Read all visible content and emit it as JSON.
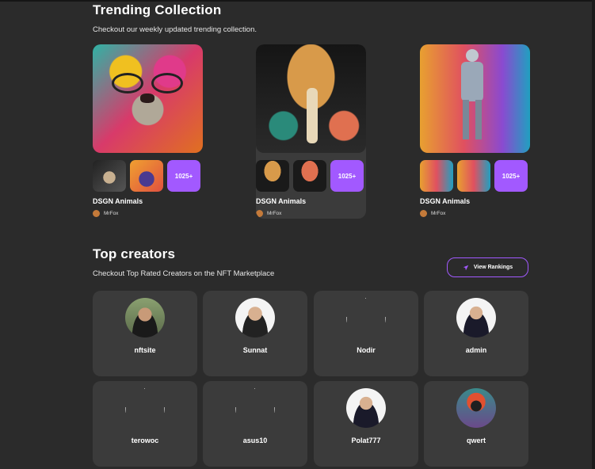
{
  "trending": {
    "title": "Trending Collection",
    "subtitle": "Checkout our weekly updated trending collection.",
    "collections": [
      {
        "name": "DSGN Animals",
        "artist": "MrFox",
        "count": "1025+"
      },
      {
        "name": "DSGN Animals",
        "artist": "MrFox",
        "count": "1025+"
      },
      {
        "name": "DSGN Animals",
        "artist": "MrFox",
        "count": "1025+"
      }
    ]
  },
  "creators": {
    "title": "Top creators",
    "subtitle": "Checkout Top Rated Creators on the NFT Marketplace",
    "button_label": "View Rankings",
    "items": [
      {
        "name": "nftsite"
      },
      {
        "name": "Sunnat"
      },
      {
        "name": "Nodir"
      },
      {
        "name": "admin"
      },
      {
        "name": "terowoc"
      },
      {
        "name": "asus10"
      },
      {
        "name": "Polat777"
      },
      {
        "name": "qwert"
      }
    ]
  },
  "colors": {
    "background": "#2b2b2b",
    "card": "#3b3b3b",
    "accent": "#a259ff"
  }
}
